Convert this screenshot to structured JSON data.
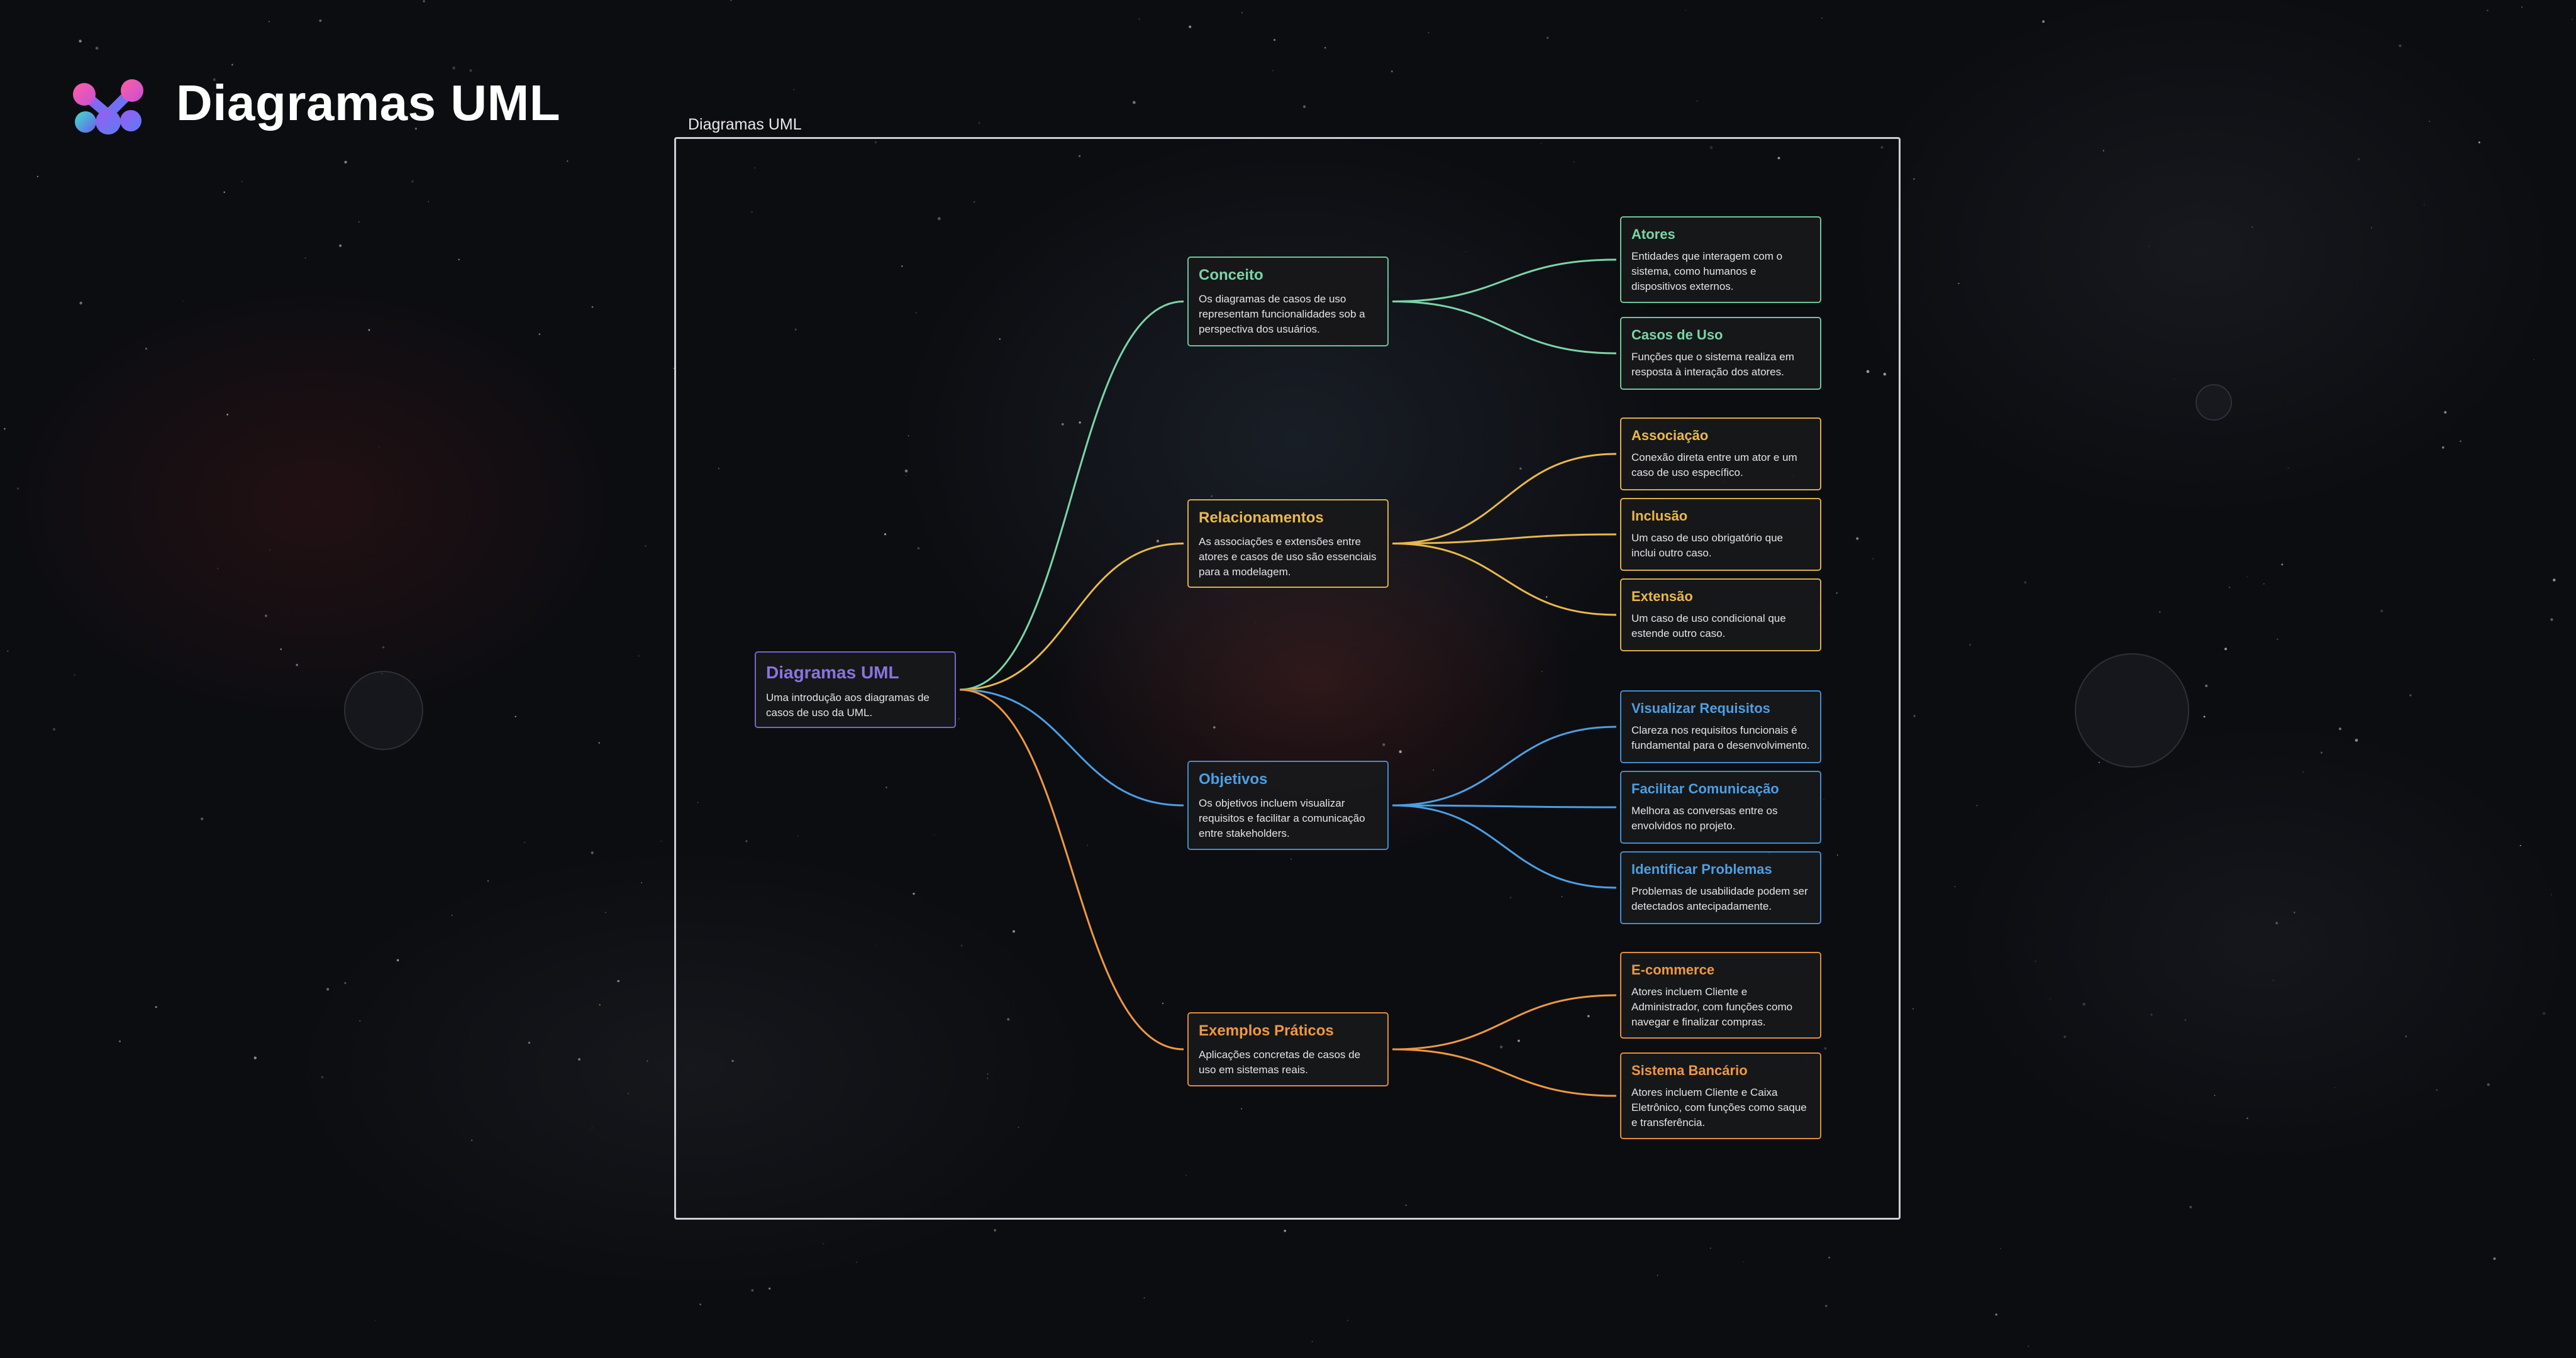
{
  "app": {
    "title": "Diagramas UML"
  },
  "frame": {
    "label": "Diagramas UML"
  },
  "colors": {
    "root": "#8b73e0",
    "concept": "#7ad4a6",
    "relations": "#e8b84a",
    "objectives": "#4c9fe3",
    "examples": "#ee9840",
    "frame": "#c9ced6"
  },
  "nodes": {
    "root": {
      "title": "Diagramas UML",
      "desc": "Uma introdução aos diagramas de casos de uso da UML."
    },
    "conceito": {
      "title": "Conceito",
      "desc": "Os diagramas de casos de uso representam funcionalidades sob a perspectiva dos usuários.",
      "children": [
        {
          "title": "Atores",
          "desc": "Entidades que interagem com o sistema, como humanos e dispositivos externos."
        },
        {
          "title": "Casos de Uso",
          "desc": "Funções que o sistema realiza em resposta à interação dos atores."
        }
      ]
    },
    "relacionamentos": {
      "title": "Relacionamentos",
      "desc": "As associações e extensões entre atores e casos de uso são essenciais para a modelagem.",
      "children": [
        {
          "title": "Associação",
          "desc": "Conexão direta entre um ator e um caso de uso específico."
        },
        {
          "title": "Inclusão",
          "desc": "Um caso de uso obrigatório que inclui outro caso."
        },
        {
          "title": "Extensão",
          "desc": "Um caso de uso condicional que estende outro caso."
        }
      ]
    },
    "objetivos": {
      "title": "Objetivos",
      "desc": "Os objetivos incluem visualizar requisitos e facilitar a comunicação entre stakeholders.",
      "children": [
        {
          "title": "Visualizar Requisitos",
          "desc": "Clareza nos requisitos funcionais é fundamental para o desenvolvimento."
        },
        {
          "title": "Facilitar Comunicação",
          "desc": "Melhora as conversas entre os envolvidos no projeto."
        },
        {
          "title": "Identificar Problemas",
          "desc": "Problemas de usabilidade podem ser detectados antecipadamente."
        }
      ]
    },
    "exemplos": {
      "title": "Exemplos Práticos",
      "desc": "Aplicações concretas de casos de uso em sistemas reais.",
      "children": [
        {
          "title": "E-commerce",
          "desc": "Atores incluem Cliente e Administrador, com funções como navegar e finalizar compras."
        },
        {
          "title": "Sistema Bancário",
          "desc": "Atores incluem Cliente e Caixa Eletrônico, com funções como saque e transferência."
        }
      ]
    }
  }
}
